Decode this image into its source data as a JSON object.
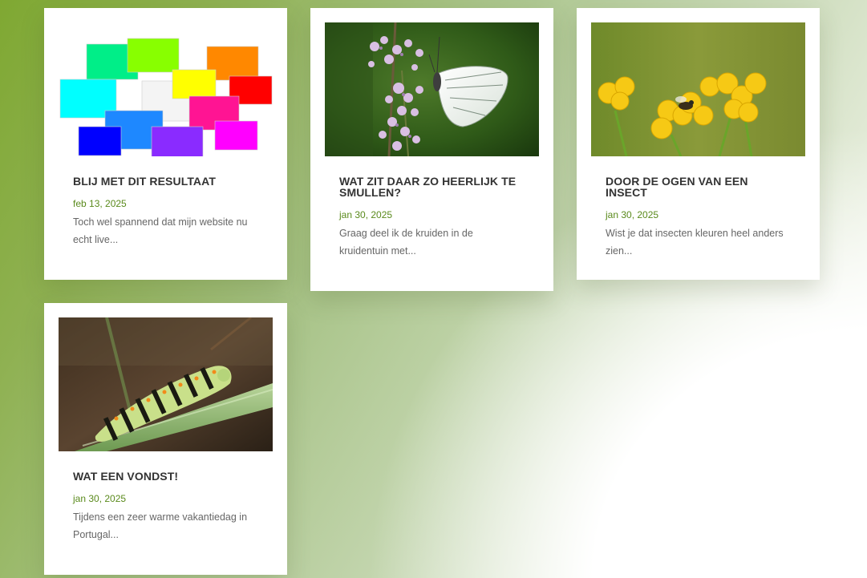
{
  "posts": [
    {
      "title": "BLIJ MET DIT RESULTAAT",
      "date": "feb 13, 2025",
      "excerpt": "Toch wel spannend dat mijn website nu echt live...",
      "image": "colored-rectangles-image"
    },
    {
      "title": "WAT ZIT DAAR ZO HEERLIJK TE SMULLEN?",
      "date": "jan 30, 2025",
      "excerpt": "Graag deel ik de kruiden in de kruidentuin met...",
      "image": "butterfly-on-thyme-image"
    },
    {
      "title": "DOOR DE OGEN VAN EEN INSECT",
      "date": "jan 30, 2025",
      "excerpt": "Wist je dat insecten kleuren heel anders zien...",
      "image": "bee-on-yellow-flowers-image"
    },
    {
      "title": "WAT EEN VONDST!",
      "date": "jan 30, 2025",
      "excerpt": "Tijdens een zeer warme vakantiedag in Portugal...",
      "image": "caterpillar-image"
    }
  ],
  "colors": {
    "accent_date": "#5a8a1c",
    "title": "#333333",
    "excerpt": "#666666"
  }
}
